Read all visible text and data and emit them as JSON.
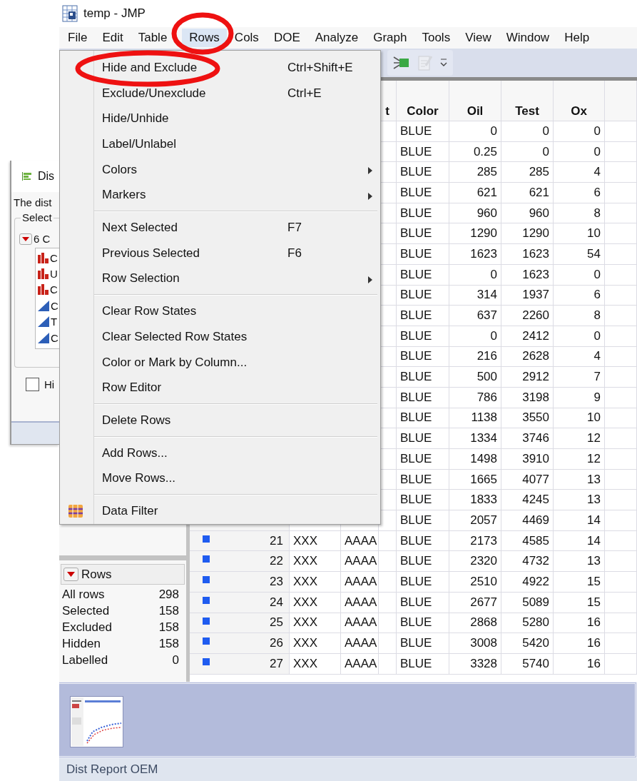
{
  "window": {
    "title": "temp - JMP"
  },
  "menu_bar": [
    {
      "label": "File",
      "selected": false
    },
    {
      "label": "Edit",
      "selected": false
    },
    {
      "label": "Table",
      "selected": false
    },
    {
      "label": "Rows",
      "selected": true
    },
    {
      "label": "Cols",
      "selected": false
    },
    {
      "label": "DOE",
      "selected": false
    },
    {
      "label": "Analyze",
      "selected": false
    },
    {
      "label": "Graph",
      "selected": false
    },
    {
      "label": "Tools",
      "selected": false
    },
    {
      "label": "View",
      "selected": false
    },
    {
      "label": "Window",
      "selected": false
    },
    {
      "label": "Help",
      "selected": false
    }
  ],
  "toolbar": {
    "buttons": [
      {
        "kind": "network",
        "disabled": false
      },
      {
        "kind": "notes",
        "disabled": true
      },
      {
        "kind": "overflow",
        "disabled": false
      }
    ]
  },
  "rows_menu": {
    "groups": [
      [
        {
          "label": "Hide and Exclude",
          "shortcut": "Ctrl+Shift+E",
          "submenu": false,
          "icon": false
        },
        {
          "label": "Exclude/Unexclude",
          "shortcut": "Ctrl+E",
          "submenu": false,
          "icon": false
        },
        {
          "label": "Hide/Unhide",
          "submenu": false,
          "icon": false
        },
        {
          "label": "Label/Unlabel",
          "submenu": false,
          "icon": false
        },
        {
          "label": "Colors",
          "submenu": true,
          "icon": false
        },
        {
          "label": "Markers",
          "submenu": true,
          "icon": false
        }
      ],
      [
        {
          "label": "Next Selected",
          "shortcut": "F7",
          "submenu": false,
          "icon": false
        },
        {
          "label": "Previous Selected",
          "shortcut": "F6",
          "submenu": false,
          "icon": false
        },
        {
          "label": "Row Selection",
          "submenu": true,
          "icon": false
        }
      ],
      [
        {
          "label": "Clear Row States",
          "submenu": false,
          "icon": false
        },
        {
          "label": "Clear Selected Row States",
          "submenu": false,
          "icon": false
        },
        {
          "label": "Color or Mark by Column...",
          "submenu": false,
          "icon": false
        },
        {
          "label": "Row Editor",
          "submenu": false,
          "icon": false
        }
      ],
      [
        {
          "label": "Delete Rows",
          "submenu": false,
          "icon": false
        }
      ],
      [
        {
          "label": "Add Rows...",
          "submenu": false,
          "icon": false
        },
        {
          "label": "Move Rows...",
          "submenu": false,
          "icon": false
        }
      ],
      [
        {
          "label": "Data Filter",
          "submenu": false,
          "icon": true
        }
      ]
    ]
  },
  "dialog": {
    "title": "Dis",
    "text": "The dist",
    "group_label": "Select",
    "list_header": "6 C",
    "columns": [
      {
        "kind": "nominal",
        "label": "C"
      },
      {
        "kind": "nominal",
        "label": "U"
      },
      {
        "kind": "nominal",
        "label": "C"
      },
      {
        "kind": "continuous",
        "label": "C"
      },
      {
        "kind": "continuous",
        "label": "T"
      },
      {
        "kind": "continuous",
        "label": "C"
      }
    ],
    "checkbox": {
      "label": "Hi",
      "checked": false
    }
  },
  "table": {
    "columns": [
      "t",
      "Color",
      "Oil",
      "Test",
      "Ox"
    ],
    "rows": [
      {
        "color_column": "BLUE",
        "oil": "0",
        "test": "0",
        "ox": "0"
      },
      {
        "color_column": "BLUE",
        "oil": "0.25",
        "test": "0",
        "ox": "0"
      },
      {
        "color_column": "BLUE",
        "oil": "285",
        "test": "285",
        "ox": "4"
      },
      {
        "color_column": "BLUE",
        "oil": "621",
        "test": "621",
        "ox": "6"
      },
      {
        "color_column": "BLUE",
        "oil": "960",
        "test": "960",
        "ox": "8"
      },
      {
        "color_column": "BLUE",
        "oil": "1290",
        "test": "1290",
        "ox": "10"
      },
      {
        "color_column": "BLUE",
        "oil": "1623",
        "test": "1623",
        "ox": "54"
      },
      {
        "color_column": "BLUE",
        "oil": "0",
        "test": "1623",
        "ox": "0"
      },
      {
        "color_column": "BLUE",
        "oil": "314",
        "test": "1937",
        "ox": "6"
      },
      {
        "color_column": "BLUE",
        "oil": "637",
        "test": "2260",
        "ox": "8"
      },
      {
        "color_column": "BLUE",
        "oil": "0",
        "test": "2412",
        "ox": "0"
      },
      {
        "color_column": "BLUE",
        "oil": "216",
        "test": "2628",
        "ox": "4"
      },
      {
        "color_column": "BLUE",
        "oil": "500",
        "test": "2912",
        "ox": "7"
      },
      {
        "color_column": "BLUE",
        "oil": "786",
        "test": "3198",
        "ox": "9"
      },
      {
        "color_column": "BLUE",
        "oil": "1138",
        "test": "3550",
        "ox": "10"
      },
      {
        "color_column": "BLUE",
        "oil": "1334",
        "test": "3746",
        "ox": "12"
      },
      {
        "color_column": "BLUE",
        "oil": "1498",
        "test": "3910",
        "ox": "12"
      },
      {
        "color_column": "BLUE",
        "oil": "1665",
        "test": "4077",
        "ox": "13"
      },
      {
        "color_column": "BLUE",
        "oil": "1833",
        "test": "4245",
        "ox": "13"
      },
      {
        "color_column": "BLUE",
        "oil": "2057",
        "test": "4469",
        "ox": "14"
      },
      {
        "marker": true,
        "row_number": "21",
        "column_2": "XXX",
        "column_3": "AAAA",
        "color_column": "BLUE",
        "oil": "2173",
        "test": "4585",
        "ox": "14"
      },
      {
        "marker": true,
        "row_number": "22",
        "column_2": "XXX",
        "column_3": "AAAA",
        "color_column": "BLUE",
        "oil": "2320",
        "test": "4732",
        "ox": "13"
      },
      {
        "marker": true,
        "row_number": "23",
        "column_2": "XXX",
        "column_3": "AAAA",
        "color_column": "BLUE",
        "oil": "2510",
        "test": "4922",
        "ox": "15"
      },
      {
        "marker": true,
        "row_number": "24",
        "column_2": "XXX",
        "column_3": "AAAA",
        "color_column": "BLUE",
        "oil": "2677",
        "test": "5089",
        "ox": "15"
      },
      {
        "marker": true,
        "row_number": "25",
        "column_2": "XXX",
        "column_3": "AAAA",
        "color_column": "BLUE",
        "oil": "2868",
        "test": "5280",
        "ox": "16"
      },
      {
        "marker": true,
        "row_number": "26",
        "column_2": "XXX",
        "column_3": "AAAA",
        "color_column": "BLUE",
        "oil": "3008",
        "test": "5420",
        "ox": "16"
      },
      {
        "marker": true,
        "row_number": "27",
        "column_2": "XXX",
        "column_3": "AAAA",
        "color_column": "BLUE",
        "oil": "3328",
        "test": "5740",
        "ox": "16"
      }
    ]
  },
  "rows_panel": {
    "title": "Rows",
    "stats": [
      {
        "label": "All rows",
        "value": "298"
      },
      {
        "label": "Selected",
        "value": "158"
      },
      {
        "label": "Excluded",
        "value": "158"
      },
      {
        "label": "Hidden",
        "value": "158"
      },
      {
        "label": "Labelled",
        "value": "0"
      }
    ]
  },
  "report_strip": {
    "thumbnails": [
      {
        "kind": "report"
      }
    ]
  },
  "status_bar": {
    "text": "Dist Report OEM"
  },
  "annotations": [
    {
      "kind": "ellipse"
    },
    {
      "kind": "ellipse"
    }
  ]
}
